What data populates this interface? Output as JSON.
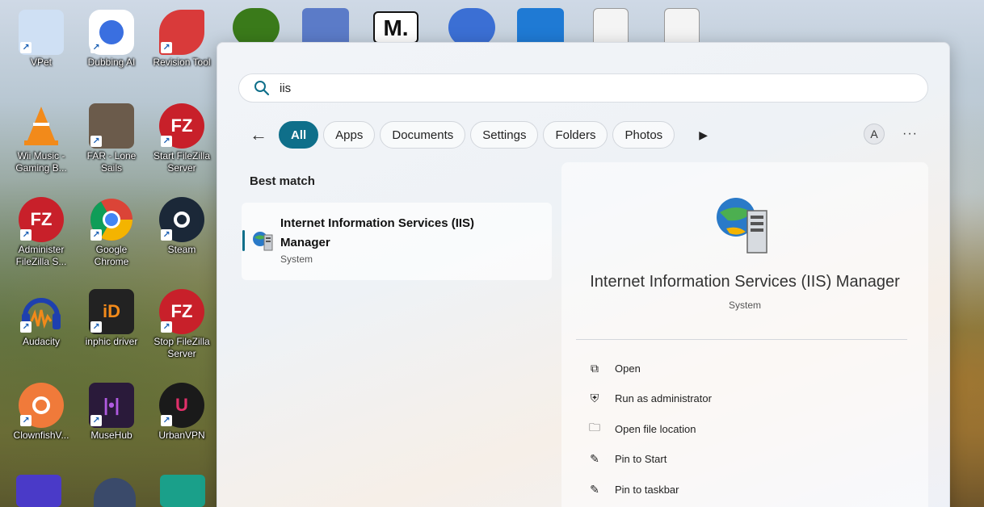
{
  "desktop": {
    "icons": [
      {
        "label": "VPet",
        "color": "#5b8fd6"
      },
      {
        "label": "Dubbing AI",
        "color": "#ffffff"
      },
      {
        "label": "Revision Tool",
        "color": "#d93a3a"
      },
      {
        "label": "Wii Music - Gaming B...",
        "color": "#f28a1a"
      },
      {
        "label": "FAR - Lone Sails",
        "color": "#6b5b4b"
      },
      {
        "label": "Start FileZilla Server",
        "color": "#c8202a"
      },
      {
        "label": "Administer FileZilla S...",
        "color": "#c8202a"
      },
      {
        "label": "Google Chrome",
        "color": "#ffffff"
      },
      {
        "label": "Steam",
        "color": "#1b2838"
      },
      {
        "label": "Audacity",
        "color": "#1e40af"
      },
      {
        "label": "inphic driver",
        "color": "#222222"
      },
      {
        "label": "Stop FileZilla Server",
        "color": "#c8202a"
      },
      {
        "label": "ClownfishV...",
        "color": "#f07a3a"
      },
      {
        "label": "MuseHub",
        "color": "#2a1a3a"
      },
      {
        "label": "UrbanVPN",
        "color": "#1a1a1a"
      }
    ],
    "top_logo_text": "M."
  },
  "search": {
    "query": "iis",
    "filters": [
      "All",
      "Apps",
      "Documents",
      "Settings",
      "Folders",
      "Photos"
    ],
    "avatar_letter": "A",
    "more": "···"
  },
  "results": {
    "best_match_label": "Best match",
    "top": {
      "title": "Internet Information Services (IIS) Manager",
      "subtitle": "System"
    }
  },
  "detail": {
    "title": "Internet Information Services (IIS) Manager",
    "subtitle": "System",
    "actions": [
      {
        "label": "Open",
        "icon": "open-external-icon"
      },
      {
        "label": "Run as administrator",
        "icon": "shield-icon"
      },
      {
        "label": "Open file location",
        "icon": "folder-icon"
      },
      {
        "label": "Pin to Start",
        "icon": "pin-icon"
      },
      {
        "label": "Pin to taskbar",
        "icon": "pin-icon"
      }
    ]
  },
  "colors": {
    "accent": "#0f6f8a"
  }
}
